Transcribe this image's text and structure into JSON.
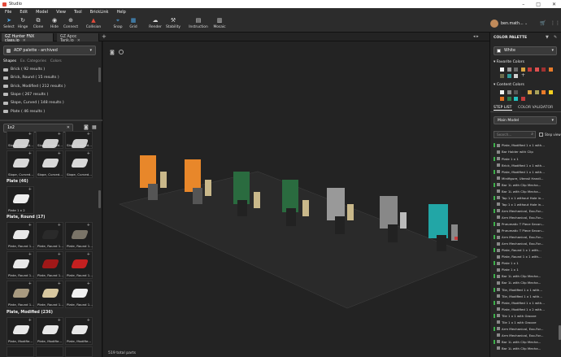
{
  "app": {
    "title": "Studio"
  },
  "menu": [
    "File",
    "Edit",
    "Model",
    "View",
    "Tool",
    "BrickLink",
    "Help"
  ],
  "toolbar": [
    {
      "label": "Select",
      "icon": "cursor-icon"
    },
    {
      "label": "Hinge",
      "icon": "hinge-icon"
    },
    {
      "label": "Clone",
      "icon": "clone-icon"
    },
    {
      "label": "Hide",
      "icon": "eye-icon"
    },
    {
      "label": "Connect",
      "icon": "connect-icon"
    },
    {
      "label": "Collision",
      "icon": "collision-icon"
    },
    {
      "label": "Snap",
      "icon": "snap-icon"
    },
    {
      "label": "Grid",
      "icon": "grid-icon"
    },
    {
      "label": "Render",
      "icon": "render-icon"
    },
    {
      "label": "Stability",
      "icon": "stability-icon"
    },
    {
      "label": "Instruction",
      "icon": "instruction-icon"
    },
    {
      "label": "Mosaic",
      "icon": "mosaic-icon"
    }
  ],
  "user": {
    "name": "ben.math..."
  },
  "tabs": [
    {
      "label": "GZ Hunter FNX class.io"
    },
    {
      "label": "GZ Apoc Tank.io"
    }
  ],
  "palette": {
    "name": "ADP palette - archived",
    "subtabs": [
      "Shapes",
      "Ex. Categories",
      "Colors"
    ],
    "shapes": [
      "Brick ( 92 results )",
      "Brick, Round ( 15 results )",
      "Brick, Modified ( 212 results )",
      "Slope ( 267 results )",
      "Slope, Curved ( 148 results )",
      "Plate ( 46 results )"
    ],
    "search_value": "1x2"
  },
  "top_cells": [
    "Slope, Curved...",
    "Slope, Curved...",
    "Slope, Curved...",
    "Slope, Curved...",
    "Slope, Curved...",
    "Slope, Curved..."
  ],
  "groups": [
    {
      "title": "Plate (46)",
      "items": [
        "Plate 1 x 2"
      ]
    },
    {
      "title": "Plate, Round (17)",
      "items": [
        "Plate, Round 1...",
        "Plate, Round 1...",
        "Plate, Round 1...",
        "Plate, Round 1...",
        "Plate, Round 1...",
        "Plate, Round 1...",
        "Plate, Round 1...",
        "Plate, Round 1...",
        "Plate, Round 1..."
      ]
    },
    {
      "title": "Plate, Modified (236)",
      "items": [
        "Plate, Modifie...",
        "Plate, Modifie...",
        "Plate, Modifie..."
      ]
    }
  ],
  "status": {
    "parts": "519 total parts"
  },
  "color_palette": {
    "title": "COLOR PALETTE",
    "selected": "White",
    "favorite_title": "Favorite Colors",
    "content_title": "Content Colors",
    "favorite_colors": [
      "#f2f2f2",
      "#9c9c9c",
      "#6b6b6b",
      "#d9a441",
      "#c43c3c",
      "#e05050",
      "#a03030",
      "#e87b2a",
      "#6c6b4a",
      "#2f9a9a",
      "#d0d0d0"
    ],
    "content_colors": [
      "#f2f2f2",
      "#8a8a8a",
      "#555",
      "#222",
      "#d9a441",
      "#aaa25a",
      "#e87b2a",
      "#f4d020",
      "#e07020",
      "#2a7b4a",
      "#22c0c0",
      "#c43c3c"
    ]
  },
  "steps": {
    "tabs": [
      "STEP LIST",
      "COLOR VALIDATOR"
    ],
    "model": "Main Model",
    "search_placeholder": "Search...",
    "step_view": "Step view",
    "items": [
      "Plate, Modified 1 x 1 with...",
      "Bar Holder with Clip",
      "Plate 1 x 1",
      "Brick, Modified 1 x 1 with...",
      "Plate, Modified 1 x 1 with...",
      "Minifigure, Utensil Handl...",
      "Bar 1L with Clip Mecha...",
      "Bar 1L with Clip Mecha...",
      "Tap 1 x 1 without Hole in...",
      "Tap 1 x 1 without Hole in...",
      "Arm Mechanical, Exo-For...",
      "Arm Mechanical, Exo-For...",
      "Pneumatic T Piece Secon...",
      "Pneumatic T Piece Secon...",
      "Arm Mechanical, Exo-For...",
      "Arm Mechanical, Exo-For...",
      "Plate, Round 1 x 1 with...",
      "Plate, Round 1 x 1 with...",
      "Plate 1 x 1",
      "Plate 1 x 1",
      "Bar 1L with Clip Mecha...",
      "Bar 1L with Clip Mecha...",
      "Tile, Modified 1 x 1 with...",
      "Tile, Modified 1 x 1 with...",
      "Plate, Modified 1 x 1 with...",
      "Plate, Modified 1 x 2 with...",
      "Tile 1 x 1 with Groove",
      "Tile 1 x 1 with Groove",
      "Arm Mechanical, Exo-For...",
      "Arm Mechanical, Exo-For...",
      "Bar 1L with Clip Mecha...",
      "Bar 1L with Clip Mecha..."
    ]
  }
}
